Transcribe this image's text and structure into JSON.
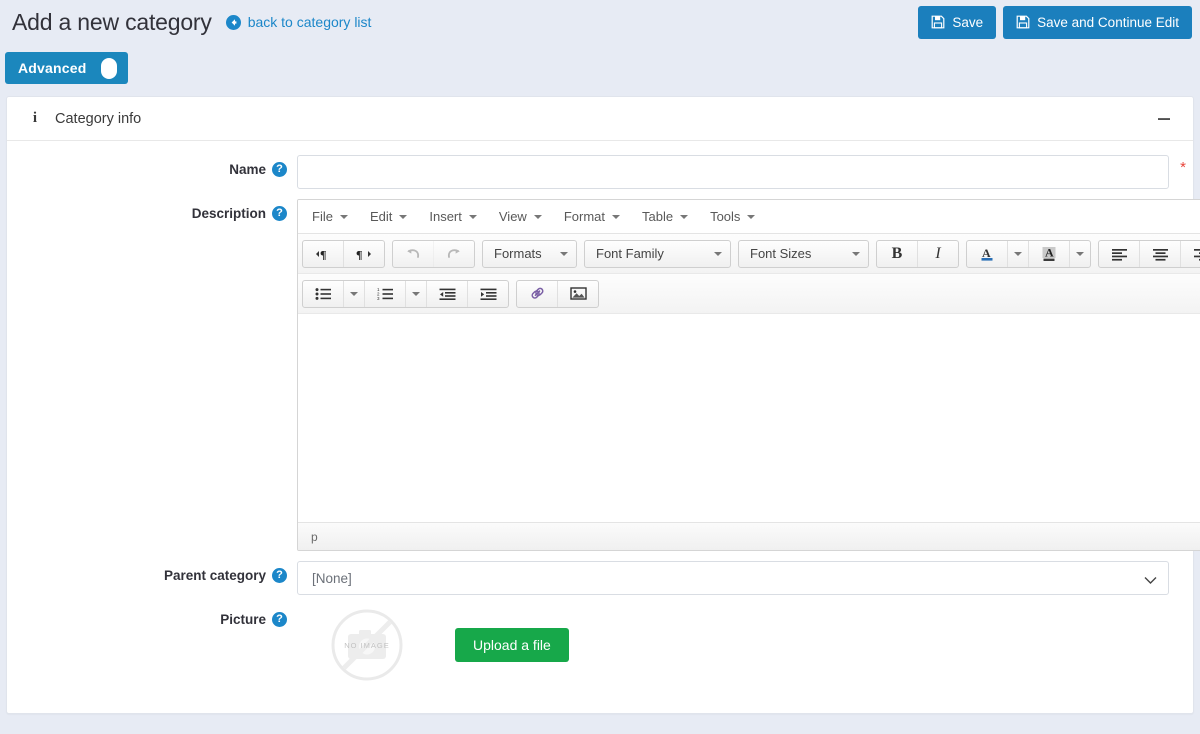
{
  "header": {
    "title": "Add a new category",
    "back_link": "back to category list",
    "back_icon": "arrow-circle-left-icon",
    "buttons": [
      {
        "label": "Save",
        "icon": "floppy-save-icon",
        "name": "save-button"
      },
      {
        "label": "Save and Continue Edit",
        "icon": "floppy-save-icon",
        "name": "save-and-continue-edit-button"
      }
    ],
    "accent_blue": "#1b7fbd",
    "background": "#e7ebf4"
  },
  "advanced_toggle": {
    "label": "Advanced",
    "state": "on",
    "color": "#1b87bd"
  },
  "panel": {
    "title": "Category info",
    "info_icon": "info-icon",
    "collapse_icon": "minus-icon"
  },
  "fields": {
    "name": {
      "label": "Name",
      "help_icon": "question-mark-icon",
      "value": "",
      "placeholder": "",
      "required_marker": "*"
    },
    "description": {
      "label": "Description",
      "help_icon": "question-mark-icon",
      "value": ""
    },
    "parent_category": {
      "label": "Parent category",
      "help_icon": "question-mark-icon",
      "selected": "[None]",
      "options": [
        "[None]"
      ]
    },
    "picture": {
      "label": "Picture",
      "help_icon": "question-mark-icon",
      "placeholder_text": "NO IMAGE",
      "upload_label": "Upload a file",
      "upload_color": "#17a84a"
    }
  },
  "editor": {
    "menubar": [
      {
        "label": "File",
        "name": "menu-file"
      },
      {
        "label": "Edit",
        "name": "menu-edit"
      },
      {
        "label": "Insert",
        "name": "menu-insert"
      },
      {
        "label": "View",
        "name": "menu-view"
      },
      {
        "label": "Format",
        "name": "menu-format"
      },
      {
        "label": "Table",
        "name": "menu-table"
      },
      {
        "label": "Tools",
        "name": "menu-tools"
      }
    ],
    "toolbar_row1": {
      "ltr": "ltr-icon",
      "rtl": "rtl-icon",
      "undo": "undo-icon",
      "redo": "redo-icon",
      "formats_label": "Formats",
      "fontfamily_label": "Font Family",
      "fontsizes_label": "Font Sizes",
      "bold": "B",
      "italic": "I",
      "textcolor": "A",
      "backcolor": "A"
    },
    "statusbar_path": "p"
  }
}
